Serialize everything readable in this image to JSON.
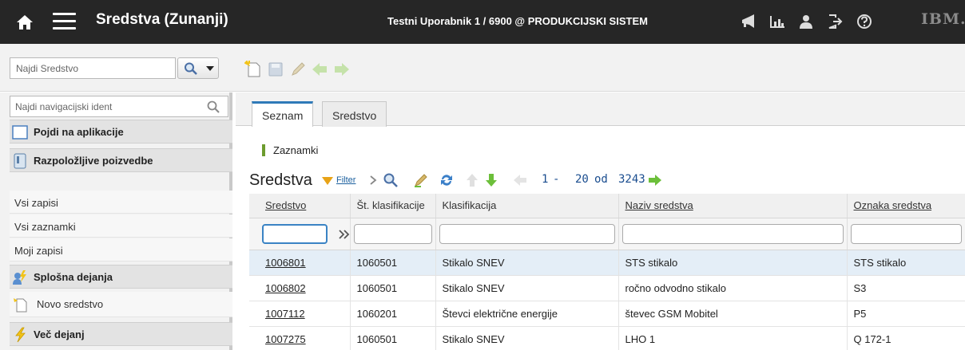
{
  "header": {
    "app_title": "Sredstva (Zunanji)",
    "user_info": "Testni Uporabnik 1 / 6900 @ PRODUKCIJSKI SISTEM",
    "brand": "IBM."
  },
  "toolbar": {
    "search_placeholder": "Najdi Sredstvo"
  },
  "nav": {
    "search_placeholder": "Najdi navigacijski ident",
    "go_to_apps": "Pojdi na aplikacije",
    "available_queries": "Razpoložljive poizvedbe",
    "queries": [
      "Vsi zapisi",
      "Vsi zaznamki",
      "Moji zapisi"
    ],
    "common_actions": "Splošna dejanja",
    "new_asset": "Novo sredstvo",
    "more_actions": "Več dejanj"
  },
  "tabs": [
    "Seznam",
    "Sredstvo"
  ],
  "main": {
    "bookmarks_label": "Zaznamki",
    "list_title": "Sredstva",
    "filter_label": "Filter",
    "pager": {
      "from": "1",
      "to": "20",
      "of_word": "od",
      "total": "3243"
    }
  },
  "table": {
    "columns": [
      "Sredstvo",
      "Št. klasifikacije",
      "Klasifikacija",
      "Naziv sredstva",
      "Oznaka sredstva"
    ],
    "rows": [
      [
        "1006801",
        "1060501",
        "Stikalo SNEV",
        "STS stikalo",
        "STS stikalo"
      ],
      [
        "1006802",
        "1060501",
        "Stikalo SNEV",
        "ročno odvodno stikalo",
        "S3"
      ],
      [
        "1007112",
        "1060201",
        "Števci električne energije",
        "števec GSM Mobitel",
        "P5"
      ],
      [
        "1007275",
        "1060501",
        "Stikalo SNEV",
        "LHO 1",
        "Q 172-1"
      ]
    ]
  },
  "colors": {
    "topbar_bg": "#262626",
    "accent": "#2f7ab8",
    "selected_row": "#e4eef7",
    "arrow_green": "#6cbf3a",
    "lightning_yellow": "#f2c318"
  }
}
